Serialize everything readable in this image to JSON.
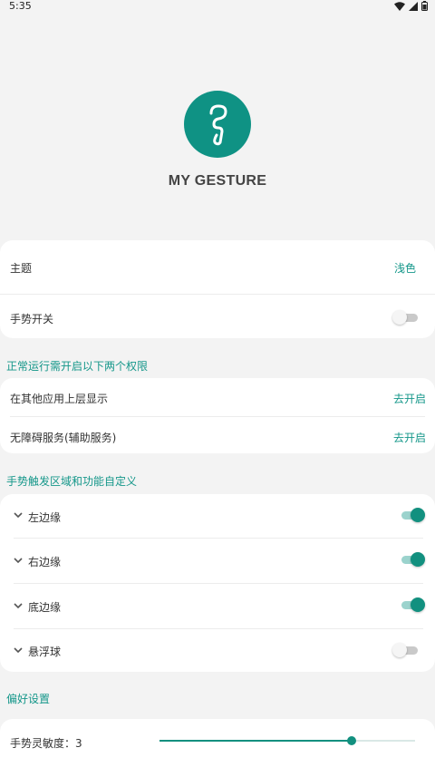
{
  "status": {
    "time": "5:35",
    "icons": [
      "wifi-icon",
      "signal-icon",
      "battery-icon"
    ]
  },
  "app": {
    "name": "MY GESTURE",
    "logo_icon": "gesture-logo-icon"
  },
  "general": {
    "theme_label": "主题",
    "theme_value": "浅色",
    "switch_label": "手势开关",
    "switch_on": false
  },
  "permissions": {
    "title": "正常运行需开启以下两个权限",
    "overlay_label": "在其他应用上层显示",
    "overlay_action": "去开启",
    "accessibility_label": "无障碍服务(辅助服务)",
    "accessibility_action": "去开启"
  },
  "gesture_areas": {
    "title": "手势触发区域和功能自定义",
    "items": [
      {
        "label": "左边缘",
        "on": true
      },
      {
        "label": "右边缘",
        "on": true
      },
      {
        "label": "底边缘",
        "on": true
      },
      {
        "label": "悬浮球",
        "on": false
      }
    ]
  },
  "preferences": {
    "title": "偏好设置",
    "sensitivity_label": "手势灵敏度：3",
    "sensitivity_fraction": 0.75
  },
  "colors": {
    "accent": "#12907f",
    "background": "#f3f3f3",
    "card": "#ffffff"
  }
}
